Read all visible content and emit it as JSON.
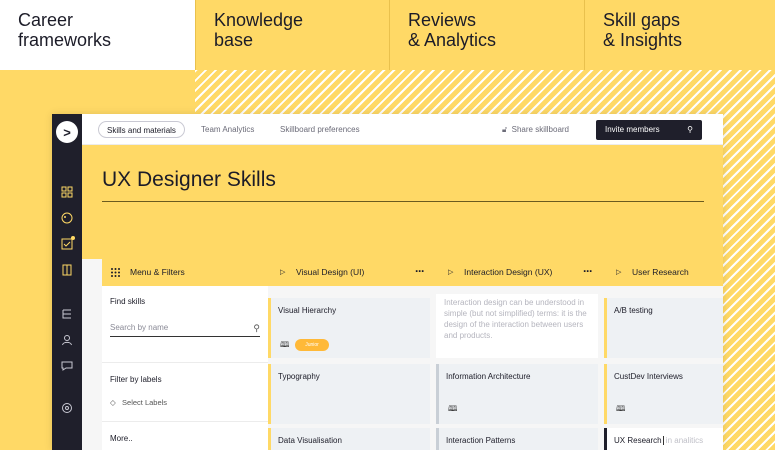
{
  "features": [
    {
      "line1": "Career",
      "line2": "frameworks"
    },
    {
      "line1": "Knowledge",
      "line2": "base"
    },
    {
      "line1": "Reviews",
      "line2": "& Analytics"
    },
    {
      "line1": "Skill gaps",
      "line2": "& Insights"
    }
  ],
  "app": {
    "logo": ">",
    "tabs": [
      "Skills and materials",
      "Team Analytics",
      "Skillboard preferences"
    ],
    "share": "Share skillboard",
    "invite": "Invite members",
    "title": "UX Designer Skills"
  },
  "columns": {
    "menu": "Menu & Filters",
    "visual": "Visual Design (UI)",
    "interaction": "Interaction Design (UX)",
    "research": "User Research"
  },
  "filters": {
    "find": "Find skills",
    "search_placeholder": "Search by name",
    "by_labels": "Filter by labels",
    "select_labels": "Select Labels",
    "more": "More.."
  },
  "cards": {
    "visual_hierarchy": "Visual Hierarchy",
    "badge": "Junior",
    "typography": "Typography",
    "data_vis": "Data Visualisation",
    "interaction_hint": "Interaction design can be understood in simple (but not simplified) terms: it is the design of the interaction between users and products.",
    "info_arch": "Information Architecture",
    "interaction_patterns": "Interaction Patterns",
    "ab_testing": "A/B testing",
    "custdev": "CustDev Interviews",
    "ux_research": "UX Research",
    "ux_research_ghost": " in analitics"
  },
  "colors": {
    "accent": "#ffd966",
    "dark": "#1f1f2b",
    "badge": "#ffb938"
  }
}
